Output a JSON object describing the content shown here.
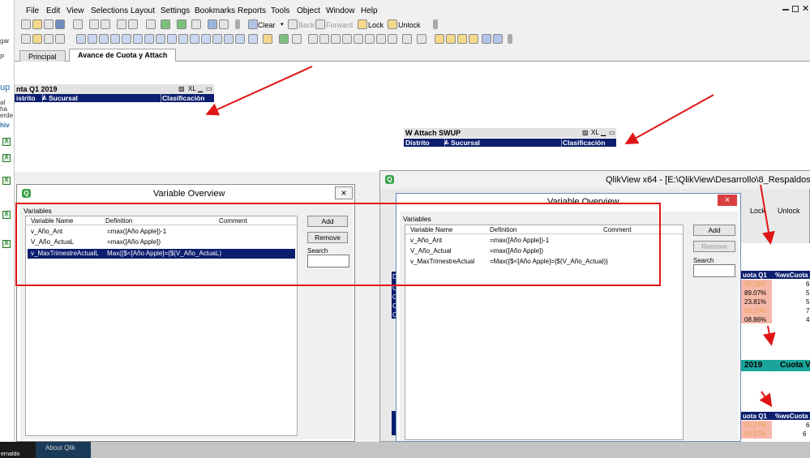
{
  "menu": [
    "File",
    "Edit",
    "View",
    "Selections",
    "Layout",
    "Settings",
    "Bookmarks",
    "Reports",
    "Tools",
    "Object",
    "Window",
    "Help"
  ],
  "toolbar": {
    "clear": "Clear",
    "back": "Back",
    "forward": "Forward",
    "lock": "Lock",
    "unlock": "Unlock"
  },
  "left_strip": [
    "gar",
    "P",
    "up",
    "al",
    "ha",
    "erde",
    "hiv"
  ],
  "tabs": [
    "Principal",
    "Avance de Cuota y Attach"
  ],
  "sheet": {
    "table1": {
      "title": "nta Q1 2019",
      "controls": "XL",
      "columns": [
        "istrito",
        "Sucursal",
        "Clasificación"
      ]
    },
    "table2": {
      "title": "W Attach SWUP",
      "controls": "XL",
      "columns": [
        "Distrito",
        "Sucursal",
        "Clasificación"
      ]
    }
  },
  "dialog1": {
    "title": "Variable Overview",
    "close": "×",
    "group_label": "Variables",
    "columns": [
      "Variable Name",
      "Definition",
      "Comment"
    ],
    "rows": [
      {
        "name": "v_Año_Ant",
        "definition": "=max([Año Apple])-1",
        "comment": ""
      },
      {
        "name": "V_Año_ActuaL",
        "definition": "=max([Año Apple])",
        "comment": ""
      },
      {
        "name": "v_MaxTrimestreActualL",
        "definition": "Max({$<[Año Apple]={$(V_Año_ActuaL)",
        "comment": ""
      }
    ],
    "buttons": {
      "add": "Add",
      "remove": "Remove"
    },
    "search_label": "Search",
    "search_value": ""
  },
  "window2": {
    "title": "QlikView x64 - [E:\\QlikView\\Desarrollo\\8_Respaldos\\F",
    "lock": "Lock",
    "unlock": "Unlock"
  },
  "dialog2": {
    "title": "Variable Overview",
    "close": "×",
    "group_label": "Variables",
    "columns": [
      "Variable Name",
      "Definition",
      "Comment"
    ],
    "rows": [
      {
        "name": "v_Año_Ant",
        "definition": "=max([Año Apple])-1",
        "comment": ""
      },
      {
        "name": "V_Año_Actual",
        "definition": "=max([Año Apple])",
        "comment": ""
      },
      {
        "name": "v_MaxTrimestreActual",
        "definition": "=Max({$<[Año Apple]={$(V_Año_Actual)}",
        "comment": ""
      }
    ],
    "buttons": {
      "add": "Add",
      "remove": "Remove"
    },
    "search_label": "Search",
    "search_value": ""
  },
  "right_data": {
    "header_a": "uota Q1",
    "header_b": "%wsCuota A",
    "rows_a": [
      "85.28%",
      "89.07%",
      "23.81%",
      "83.10%",
      "08.86%"
    ],
    "rows_a_right": [
      "6",
      "5",
      "5",
      "7",
      "4"
    ],
    "year": "2019",
    "cuota_label": "Cuota V",
    "header_c": "uota Q1",
    "header_d": "%wsCuota A",
    "rows_b": [
      "85.27%",
      "85.27%"
    ],
    "rows_b_right": [
      "6",
      "6"
    ],
    "left_stub": [
      "Di",
      "Co",
      "Co",
      "Co",
      "Co"
    ]
  },
  "taskbar": {
    "left": "ernaldo",
    "item": "About Qlik"
  },
  "colors": {
    "header_navy": "#0c1e6e",
    "annotation_red": "#e01515",
    "title_bar": "#f1f1f1",
    "teal": "#1aa59a"
  }
}
